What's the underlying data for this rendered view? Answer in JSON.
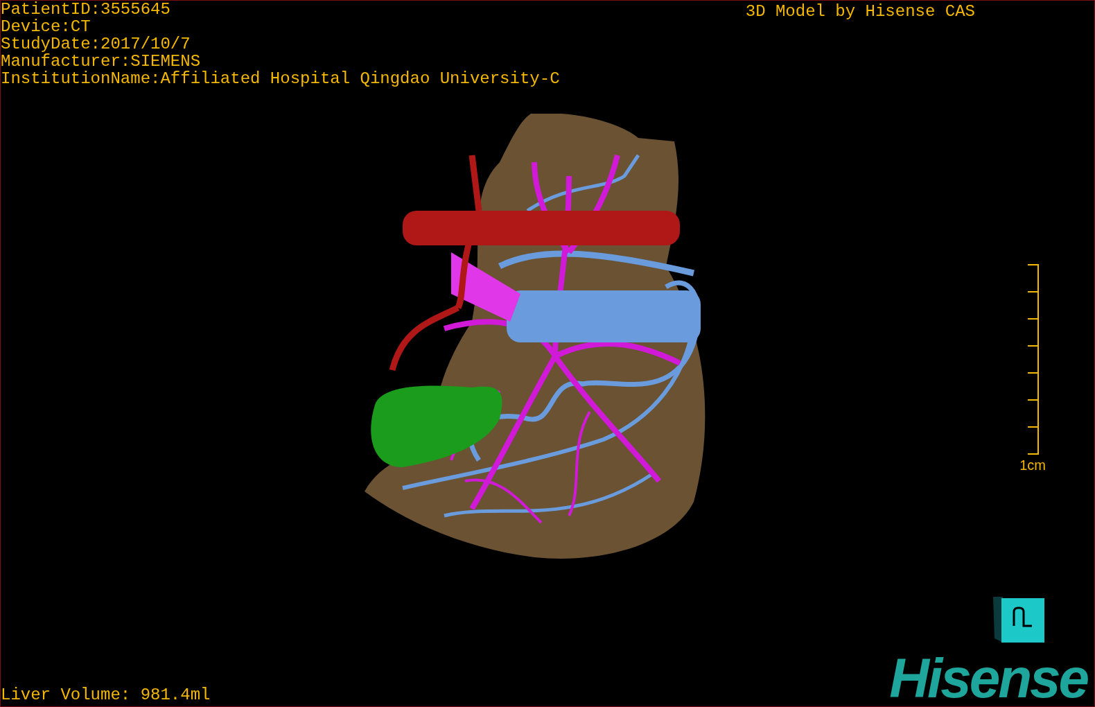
{
  "study_info": [
    "PatientID:3555645",
    "Device:CT",
    "StudyDate:2017/10/7",
    "Manufacturer:SIEMENS",
    "InstitutionName:Affiliated Hospital Qingdao University-C"
  ],
  "viewer_title": "3D Model by Hisense CAS",
  "scale_bar": {
    "label": "1cm"
  },
  "liver_volume": "Liver Volume: 981.4ml",
  "logo": "Hisense"
}
